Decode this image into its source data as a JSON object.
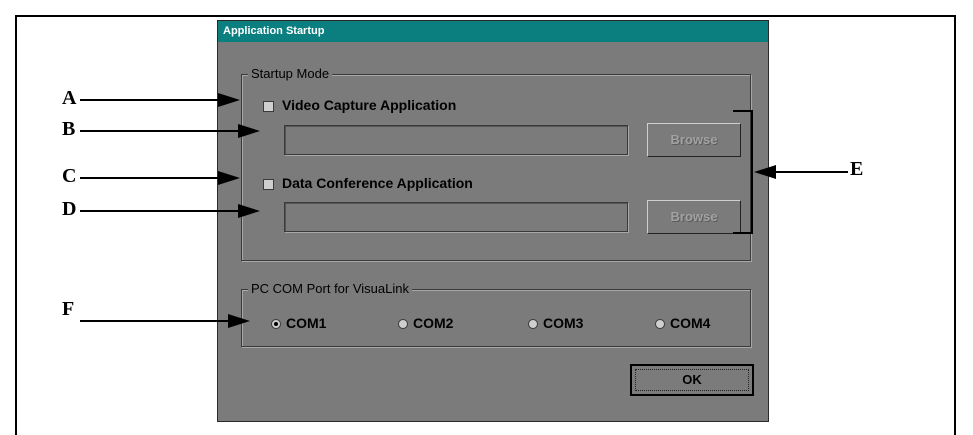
{
  "dialog": {
    "title": "Application Startup",
    "startup_mode": {
      "label": "Startup Mode",
      "video_capture": {
        "label": "Video Capture Application",
        "checked": false,
        "path": "",
        "browse_label": "Browse"
      },
      "data_conference": {
        "label": "Data Conference Application",
        "checked": false,
        "path": "",
        "browse_label": "Browse"
      }
    },
    "com_port": {
      "label": "PC COM Port for VisuaLink",
      "options": [
        "COM1",
        "COM2",
        "COM3",
        "COM4"
      ],
      "selected": "COM1"
    },
    "ok_label": "OK"
  },
  "callouts": {
    "a": "A",
    "b": "B",
    "c": "C",
    "d": "D",
    "e": "E",
    "f": "F"
  },
  "colors": {
    "titlebar": "#0b7f7f",
    "dialog_bg": "#7b7b7b"
  }
}
